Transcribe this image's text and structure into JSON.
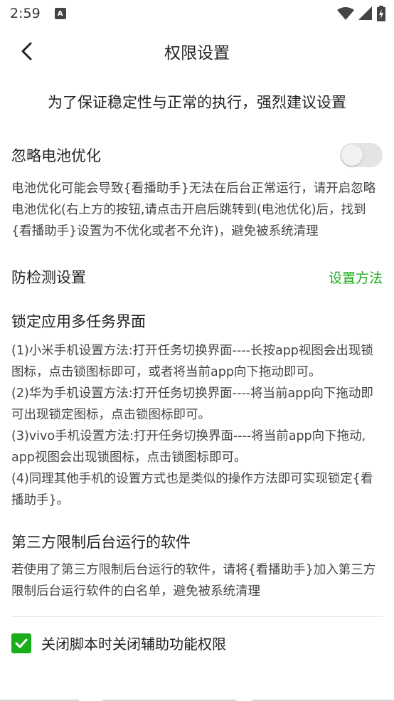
{
  "status": {
    "time": "2:59",
    "notif_letter": "A"
  },
  "appbar": {
    "title": "权限设置"
  },
  "headline": "为了保证稳定性与正常的执行，强烈建议设置",
  "battery": {
    "title": "忽略电池优化",
    "enabled": false,
    "desc": "电池优化可能会导致{看播助手}无法在后台正常运行，请开启忽略电池优化(右上方的按钮,请点击开启后跳转到(电池优化)后，找到{看播助手}设置为不优化或者不允许)，避免被系统清理"
  },
  "anti_detect": {
    "title": "防检测设置",
    "link": "设置方法"
  },
  "lock_app": {
    "title": "锁定应用多任务界面",
    "lines": [
      "(1)小米手机设置方法:打开任务切换界面----长按app视图会出现锁图标，点击锁图标即可，或者将当前app向下拖动即可。",
      "(2)华为手机设置方法:打开任务切换界面----将当前app向下拖动即可出现锁定图标，点击锁图标即可。",
      "(3)vivo手机设置方法:打开任务切换界面----将当前app向下拖动, app视图会出现锁图标，点击锁图标即可。",
      "(4)同理其他手机的设置方式也是类似的操作方法即可实现锁定{看播助手}。"
    ]
  },
  "third_party": {
    "title": "第三方限制后台运行的软件",
    "desc": "若使用了第三方限制后台运行的软件，请将{看播助手}加入第三方限制后台运行软件的白名单，避免被系统清理"
  },
  "close_option": {
    "label": "关闭脚本时关闭辅助功能权限",
    "checked": true
  },
  "colors": {
    "accent": "#1aad19",
    "toggle_off": "#e4e4e4"
  }
}
